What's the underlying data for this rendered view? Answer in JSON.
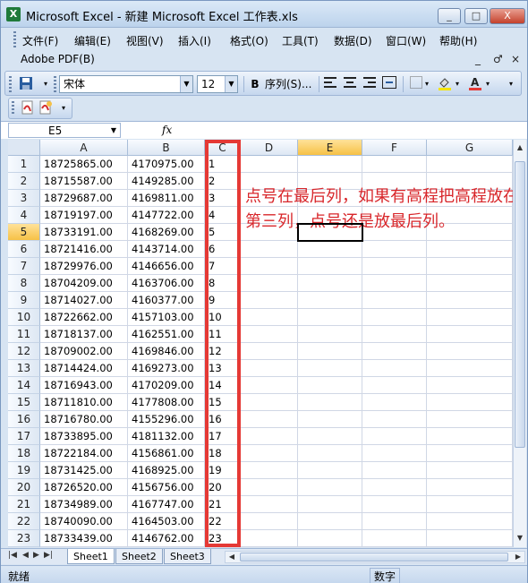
{
  "window": {
    "title": "Microsoft Excel - 新建 Microsoft Excel 工作表.xls",
    "app_icon_letter": "X",
    "min_label": "_",
    "restore_label": "□",
    "close_label": "X"
  },
  "menubar": {
    "items": [
      "文件(F)",
      "编辑(E)",
      "视图(V)",
      "插入(I)",
      "格式(O)",
      "工具(T)",
      "数据(D)",
      "窗口(W)",
      "帮助(H)"
    ],
    "adobe": "Adobe PDF(B)",
    "doc_min": "_",
    "doc_restore": "♂",
    "doc_close": "×"
  },
  "toolbar": {
    "font_name": "宋体",
    "font_size": "12",
    "bold_label": "B",
    "sequence_label": "序列(S)...",
    "font_color": "#e53935",
    "fill_color": "#f5e400"
  },
  "formula_bar": {
    "name_box": "E5",
    "fx_label": "fx",
    "content": ""
  },
  "sheet": {
    "columns": [
      "A",
      "B",
      "C",
      "D",
      "E",
      "F",
      "G"
    ],
    "active_column": "E",
    "active_row": "5",
    "rows": [
      {
        "n": "1",
        "a": "18725865.00",
        "b": "4170975.00",
        "c": "1"
      },
      {
        "n": "2",
        "a": "18715587.00",
        "b": "4149285.00",
        "c": "2"
      },
      {
        "n": "3",
        "a": "18729687.00",
        "b": "4169811.00",
        "c": "3"
      },
      {
        "n": "4",
        "a": "18719197.00",
        "b": "4147722.00",
        "c": "4"
      },
      {
        "n": "5",
        "a": "18733191.00",
        "b": "4168269.00",
        "c": "5"
      },
      {
        "n": "6",
        "a": "18721416.00",
        "b": "4143714.00",
        "c": "6"
      },
      {
        "n": "7",
        "a": "18729976.00",
        "b": "4146656.00",
        "c": "7"
      },
      {
        "n": "8",
        "a": "18704209.00",
        "b": "4163706.00",
        "c": "8"
      },
      {
        "n": "9",
        "a": "18714027.00",
        "b": "4160377.00",
        "c": "9"
      },
      {
        "n": "10",
        "a": "18722662.00",
        "b": "4157103.00",
        "c": "10"
      },
      {
        "n": "11",
        "a": "18718137.00",
        "b": "4162551.00",
        "c": "11"
      },
      {
        "n": "12",
        "a": "18709002.00",
        "b": "4169846.00",
        "c": "12"
      },
      {
        "n": "13",
        "a": "18714424.00",
        "b": "4169273.00",
        "c": "13"
      },
      {
        "n": "14",
        "a": "18716943.00",
        "b": "4170209.00",
        "c": "14"
      },
      {
        "n": "15",
        "a": "18711810.00",
        "b": "4177808.00",
        "c": "15"
      },
      {
        "n": "16",
        "a": "18716780.00",
        "b": "4155296.00",
        "c": "16"
      },
      {
        "n": "17",
        "a": "18733895.00",
        "b": "4181132.00",
        "c": "17"
      },
      {
        "n": "18",
        "a": "18722184.00",
        "b": "4156861.00",
        "c": "18"
      },
      {
        "n": "19",
        "a": "18731425.00",
        "b": "4168925.00",
        "c": "19"
      },
      {
        "n": "20",
        "a": "18726520.00",
        "b": "4156756.00",
        "c": "20"
      },
      {
        "n": "21",
        "a": "18734989.00",
        "b": "4167747.00",
        "c": "21"
      },
      {
        "n": "22",
        "a": "18740090.00",
        "b": "4164503.00",
        "c": "22"
      },
      {
        "n": "23",
        "a": "18733439.00",
        "b": "4146762.00",
        "c": "23"
      }
    ]
  },
  "annotation": {
    "text": "点号在最后列，如果有高程把高程放在第三列，点号还是放最后列。",
    "color": "#d8262a"
  },
  "tabs": [
    "Sheet1",
    "Sheet2",
    "Sheet3"
  ],
  "active_tab": "Sheet1",
  "status": {
    "left": "就绪",
    "mode": "数字"
  }
}
